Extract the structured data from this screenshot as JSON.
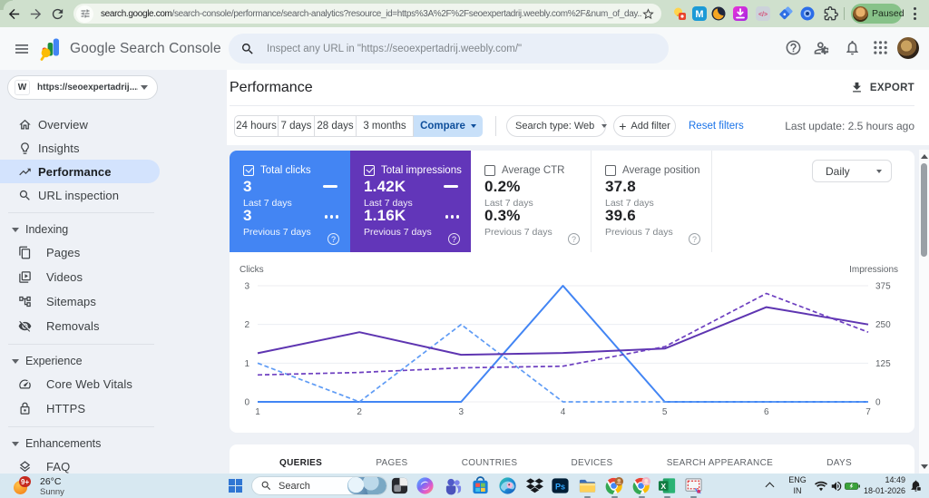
{
  "browser": {
    "url_domain": "search.google.com",
    "url_path": "/search-console/performance/search-analytics?resource_id=https%3A%2F%2Fseoexpertadrij.weebly.com%2F&num_of_day...",
    "profile_label": "Paused",
    "ps_label": "Ps",
    "code_label": "</>"
  },
  "header": {
    "product_title": "Google Search Console",
    "search_placeholder": "Inspect any URL in \"https://seoexpertadrij.weebly.com/\""
  },
  "sidebar": {
    "property": "https://seoexpertadrij....",
    "property_logo_letter": "W",
    "items": [
      {
        "label": "Overview"
      },
      {
        "label": "Insights"
      },
      {
        "label": "Performance"
      },
      {
        "label": "URL inspection"
      }
    ],
    "sections": [
      {
        "label": "Indexing",
        "items": [
          "Pages",
          "Videos",
          "Sitemaps",
          "Removals"
        ]
      },
      {
        "label": "Experience",
        "items": [
          "Core Web Vitals",
          "HTTPS"
        ]
      },
      {
        "label": "Enhancements",
        "items": [
          "FAQ"
        ]
      }
    ]
  },
  "main": {
    "title": "Performance",
    "export_label": "EXPORT",
    "filters": {
      "ranges": [
        "24 hours",
        "7 days",
        "28 days",
        "3 months"
      ],
      "compare": "Compare",
      "search_type": "Search type: Web",
      "add_filter": "Add filter",
      "plus": "+",
      "reset": "Reset filters",
      "last_update": "Last update: 2.5 hours ago"
    },
    "cards": [
      {
        "label": "Total clicks",
        "value1": "3",
        "sub1": "Last 7 days",
        "value2": "3",
        "sub2": "Previous 7 days",
        "color": "#4385f3",
        "checked": true
      },
      {
        "label": "Total impressions",
        "value1": "1.42K",
        "sub1": "Last 7 days",
        "value2": "1.16K",
        "sub2": "Previous 7 days",
        "color": "#6236b9",
        "checked": true
      },
      {
        "label": "Average CTR",
        "value1": "0.2%",
        "sub1": "Last 7 days",
        "value2": "0.3%",
        "sub2": "Previous 7 days",
        "checked": false
      },
      {
        "label": "Average position",
        "value1": "37.8",
        "sub1": "Last 7 days",
        "value2": "39.6",
        "sub2": "Previous 7 days",
        "checked": false
      }
    ],
    "question_mark": "?",
    "granularity": "Daily",
    "tabs": [
      "QUERIES",
      "PAGES",
      "COUNTRIES",
      "DEVICES",
      "SEARCH APPEARANCE",
      "DAYS"
    ]
  },
  "chart_data": {
    "type": "line",
    "x": [
      1,
      2,
      3,
      4,
      5,
      6,
      7
    ],
    "x_axis_note": "days of selected 7-day period",
    "y_left": {
      "label": "Clicks",
      "ticks": [
        0,
        1,
        2,
        3
      ],
      "max": 3
    },
    "y_right": {
      "label": "Impressions",
      "ticks": [
        0,
        125,
        250,
        375
      ],
      "max": 375
    },
    "grid": true,
    "series": [
      {
        "name": "Total clicks - Last 7 days",
        "axis": "left",
        "style": "solid",
        "color": "#4285f4",
        "values": [
          0,
          0,
          0,
          3,
          0,
          0,
          0
        ]
      },
      {
        "name": "Total clicks - Previous 7 days",
        "axis": "left",
        "style": "dashed",
        "color": "#5e9bf5",
        "values": [
          1,
          0,
          2,
          0,
          0,
          0,
          0
        ]
      },
      {
        "name": "Total impressions - Last 7 days",
        "axis": "right",
        "style": "solid",
        "color": "#5e35b1",
        "values": [
          157,
          225,
          152,
          158,
          172,
          306,
          250
        ]
      },
      {
        "name": "Total impressions - Previous 7 days",
        "axis": "right",
        "style": "dashed",
        "color": "#6d3fc0",
        "values": [
          87,
          95,
          110,
          115,
          178,
          350,
          225
        ]
      }
    ]
  },
  "taskbar": {
    "weather_badge": "9+",
    "weather_temp": "26°C",
    "weather_cond": "Sunny",
    "search_label": "Search",
    "excel_label": "X",
    "tray": {
      "lang_line1": "ENG",
      "lang_line2": "IN",
      "time": "14:49",
      "date": "18-01-2026"
    }
  }
}
